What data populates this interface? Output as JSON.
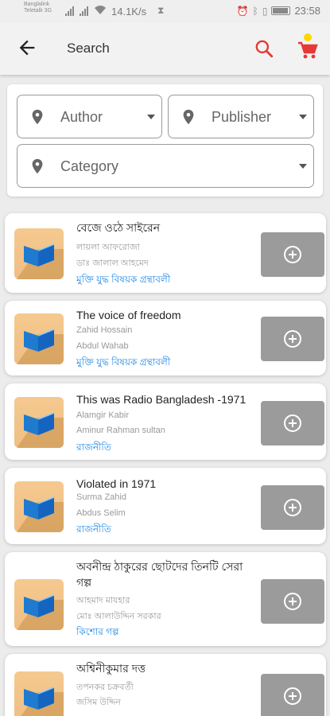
{
  "status_bar": {
    "carrier_line1": "Banglalink",
    "carrier_line2": "Teletalk 3G",
    "speed": "14.1K/s",
    "battery_level_percent": 95,
    "time": "23:58"
  },
  "app_bar": {
    "title": "Search",
    "icons": [
      "back-arrow-icon",
      "search-icon",
      "cart-icon"
    ],
    "accent_color": "#e53935",
    "cart_badge_color": "#ffd600"
  },
  "filters": {
    "author": "Author",
    "publisher": "Publisher",
    "category": "Category"
  },
  "books": [
    {
      "title": "বেজে ওঠে সাইরেন",
      "line1": "লায়লা আফরোজা",
      "line2": "ডাঃ জালাল আহমেদ",
      "category": "মুক্তি যুদ্ধ বিষয়ক গ্রন্থাবলী"
    },
    {
      "title": "The voice of freedom",
      "line1": "Zahid Hossain",
      "line2": "Abdul Wahab",
      "category": "মুক্তি যুদ্ধ বিষয়ক গ্রন্থাবলী"
    },
    {
      "title": "This was Radio Bangladesh -1971",
      "line1": "Alamgir Kabir",
      "line2": "Aminur Rahman sultan",
      "category": "রাজনীতি"
    },
    {
      "title": "Violated in 1971",
      "line1": "Surma Zahid",
      "line2": "Abdus Selim",
      "category": "রাজনীতি"
    },
    {
      "title": "অবনীন্দ্র ঠাকুরের ছোটদের তিনটি সেরা গল্প",
      "line1": "আহমাদ মাযহার",
      "line2": "মোঃ আলাউদ্দিন সরকার",
      "category": "কিশোর গল্প"
    },
    {
      "title": "অশ্বিনীকুমার দত্ত",
      "line1": "তপনকর চক্রবর্তী",
      "line2": "জসিম উদ্দিন",
      "category": ""
    }
  ],
  "colors": {
    "link": "#1e88e5",
    "add_button": "#9b9b9b",
    "book_icon": "#1e7bd0"
  }
}
